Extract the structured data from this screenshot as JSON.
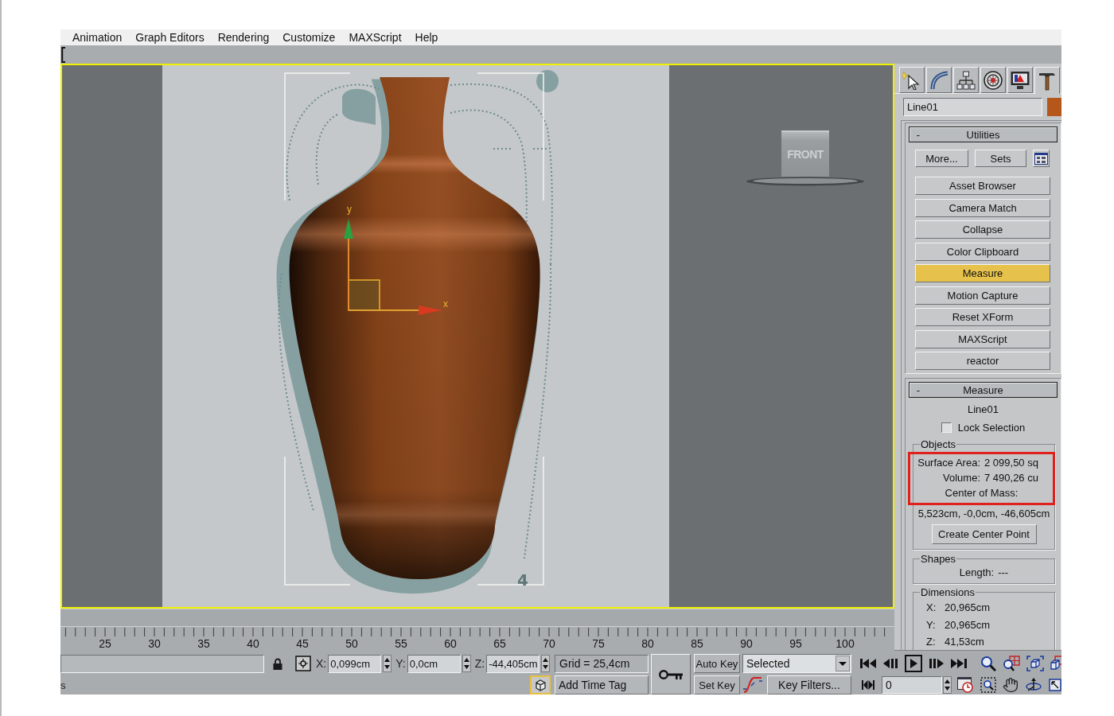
{
  "menu_bar": {
    "items": [
      "Animation",
      "Graph Editors",
      "Rendering",
      "Customize",
      "MAXScript",
      "Help"
    ]
  },
  "viewport": {
    "active": true,
    "view_cube_label": "FRONT",
    "axis_labels": [
      "y",
      "x"
    ],
    "sketch_number": "4"
  },
  "timeline": {
    "ruler_labels": [
      "25",
      "30",
      "35",
      "40",
      "45",
      "50",
      "55",
      "60",
      "65",
      "70",
      "75",
      "80",
      "85",
      "90",
      "95",
      "100"
    ]
  },
  "command_panel": {
    "tabs": [
      {
        "selected": false
      },
      {
        "selected": false
      },
      {
        "selected": false
      },
      {
        "selected": false
      },
      {
        "selected": false
      },
      {
        "selected": true
      }
    ],
    "object_name": "Line01",
    "utilities": {
      "collapse_sign": "-",
      "title": "Utilities",
      "top_buttons": [
        "More...",
        "Sets"
      ],
      "buttons": [
        {
          "label": "Asset Browser",
          "selected": false
        },
        {
          "label": "Camera Match",
          "selected": false
        },
        {
          "label": "Collapse",
          "selected": false
        },
        {
          "label": "Color Clipboard",
          "selected": false
        },
        {
          "label": "Measure",
          "selected": true
        },
        {
          "label": "Motion Capture",
          "selected": false
        },
        {
          "label": "Reset XForm",
          "selected": false
        },
        {
          "label": "MAXScript",
          "selected": false
        },
        {
          "label": "reactor",
          "selected": false
        }
      ]
    },
    "measure": {
      "collapse_sign": "-",
      "title": "Measure",
      "object": "Line01",
      "lock_selection": {
        "label": "Lock Selection",
        "checked": false
      },
      "objects_group": {
        "title": "Objects",
        "highlighted": true,
        "rows": [
          {
            "label": "Surface Area:",
            "value": "2 099,50 sq"
          },
          {
            "label": "Volume:",
            "value": "7 490,26 cu"
          }
        ],
        "center_label": "Center of Mass:",
        "center_value": "5,523cm, -0,0cm, -46,605cm",
        "button": "Create Center Point"
      },
      "shapes_group": {
        "title": "Shapes",
        "label": "Length:",
        "value": "---"
      },
      "dimensions_group": {
        "title": "Dimensions",
        "rows": [
          {
            "label": "X:",
            "value": "20,965cm"
          },
          {
            "label": "Y:",
            "value": "20,965cm"
          },
          {
            "label": "Z:",
            "value": "41,53cm"
          }
        ]
      }
    }
  },
  "status_bar": {
    "prompt_text": "s",
    "coordinates": [
      {
        "axis": "X:",
        "value": "0,099cm"
      },
      {
        "axis": "Y:",
        "value": "0,0cm"
      },
      {
        "axis": "Z:",
        "value": "-44,405cm"
      }
    ],
    "grid": "Grid = 25,4cm",
    "add_time_tag": "Add Time Tag",
    "auto_key": {
      "label": "Auto Key",
      "on": false
    },
    "set_key": "Set Key",
    "key_mode": "Selected",
    "key_filters": "Key Filters...",
    "current_frame": "0"
  }
}
